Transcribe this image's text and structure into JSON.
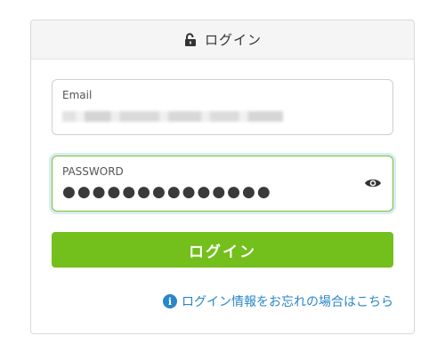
{
  "header": {
    "title": "ログイン",
    "icon": "lock-open-icon"
  },
  "email": {
    "label": "Email",
    "value_blurred": true
  },
  "password": {
    "label": "PASSWORD",
    "value": "●●●●●●●●●●●●●●",
    "toggle_icon": "eye-icon"
  },
  "login_button": {
    "label": "ログイン"
  },
  "forgot_link": {
    "label": "ログイン情報をお忘れの場合はこちら",
    "icon": "info-icon"
  },
  "colors": {
    "accent_green": "#73bf1b",
    "link_blue": "#2a86c8",
    "focus_border": "#7cc22b"
  }
}
